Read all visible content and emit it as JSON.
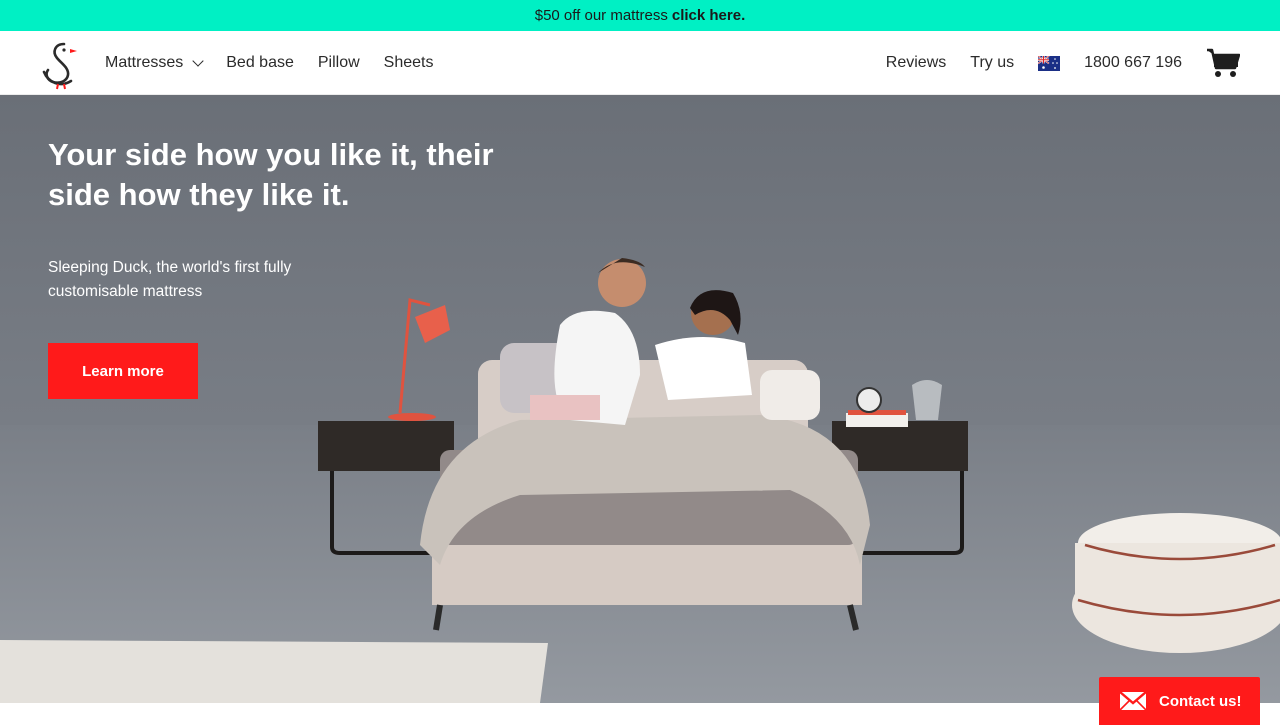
{
  "promo": {
    "text": "$50 off our mattress",
    "link": "click here."
  },
  "header": {
    "logo_name": "sleeping-duck-logo",
    "nav_left": [
      {
        "label": "Mattresses",
        "has_dropdown": true
      },
      {
        "label": "Bed base"
      },
      {
        "label": "Pillow"
      },
      {
        "label": "Sheets"
      }
    ],
    "nav_right": {
      "reviews": "Reviews",
      "try_us": "Try us",
      "flag": "australia-flag",
      "phone": "1800 667 196",
      "cart": "cart-icon"
    }
  },
  "hero": {
    "title": "Your side how you like it, their side how they like it.",
    "subtitle": "Sleeping Duck, the world's first fully customisable mattress",
    "cta": "Learn more"
  },
  "contact": {
    "label": "Contact us!",
    "icon": "envelope-icon"
  },
  "colors": {
    "promo_bg": "#00f0c4",
    "accent_red": "#ff1a1a",
    "text": "#2b2b2b"
  }
}
